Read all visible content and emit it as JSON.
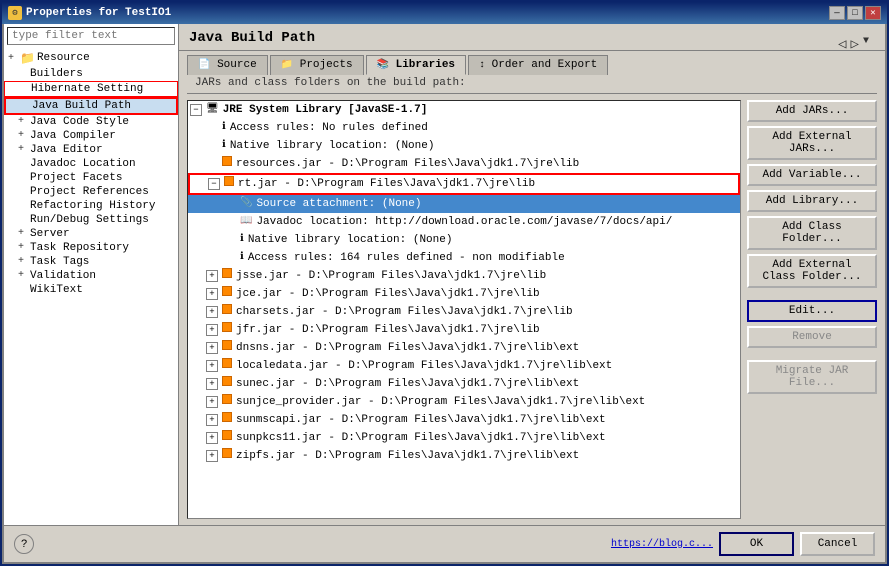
{
  "window": {
    "title": "Properties for TestIO1",
    "title_icon": "⚙"
  },
  "title_buttons": [
    "—",
    "□",
    "✕"
  ],
  "sidebar": {
    "filter_placeholder": "type filter text",
    "items": [
      {
        "label": "Resource",
        "level": 0,
        "expand": "+",
        "icon": "folder"
      },
      {
        "label": "Builders",
        "level": 1,
        "expand": "",
        "icon": ""
      },
      {
        "label": "Hibernate Setting",
        "level": 1,
        "expand": "",
        "icon": ""
      },
      {
        "label": "Java Build Path",
        "level": 1,
        "expand": "",
        "icon": "",
        "highlighted": true
      },
      {
        "label": "Java Code Style",
        "level": 1,
        "expand": "+",
        "icon": ""
      },
      {
        "label": "Java Compiler",
        "level": 1,
        "expand": "+",
        "icon": ""
      },
      {
        "label": "Java Editor",
        "level": 1,
        "expand": "+",
        "icon": ""
      },
      {
        "label": "Javadoc Location",
        "level": 1,
        "expand": "",
        "icon": ""
      },
      {
        "label": "Project Facets",
        "level": 1,
        "expand": "",
        "icon": ""
      },
      {
        "label": "Project References",
        "level": 1,
        "expand": "",
        "icon": ""
      },
      {
        "label": "Refactoring History",
        "level": 1,
        "expand": "",
        "icon": ""
      },
      {
        "label": "Run/Debug Settings",
        "level": 1,
        "expand": "",
        "icon": ""
      },
      {
        "label": "Server",
        "level": 1,
        "expand": "+",
        "icon": ""
      },
      {
        "label": "Task Repository",
        "level": 1,
        "expand": "+",
        "icon": ""
      },
      {
        "label": "Task Tags",
        "level": 1,
        "expand": "+",
        "icon": ""
      },
      {
        "label": "Validation",
        "level": 1,
        "expand": "+",
        "icon": ""
      },
      {
        "label": "WikiText",
        "level": 1,
        "expand": "",
        "icon": ""
      }
    ]
  },
  "main": {
    "title": "Java Build Path",
    "tabs": [
      {
        "label": "Source",
        "icon": "📄",
        "active": false
      },
      {
        "label": "Projects",
        "icon": "📁",
        "active": false
      },
      {
        "label": "Libraries",
        "icon": "📚",
        "active": true
      },
      {
        "label": "Order and Export",
        "icon": "📋",
        "active": false
      }
    ],
    "desc": "JARs and class folders on the build path:",
    "tree_items": [
      {
        "indent": 0,
        "expand": "−",
        "icon": "jre",
        "text": "JRE System Library [JavaSE-1.7]",
        "bold": true
      },
      {
        "indent": 1,
        "expand": "",
        "icon": "info",
        "text": "Access rules: No rules defined"
      },
      {
        "indent": 1,
        "expand": "",
        "icon": "info",
        "text": "Native library location: (None)"
      },
      {
        "indent": 1,
        "expand": "",
        "icon": "jar",
        "text": "resources.jar - D:\\Program Files\\Java\\jdk1.7\\jre\\lib"
      },
      {
        "indent": 1,
        "expand": "−",
        "icon": "jar",
        "text": "rt.jar - D:\\Program Files\\Java\\jdk1.7\\jre\\lib",
        "highlighted": true
      },
      {
        "indent": 2,
        "expand": "",
        "icon": "src",
        "text": "Source attachment: (None)",
        "selected": true
      },
      {
        "indent": 2,
        "expand": "",
        "icon": "info",
        "text": "Javadoc location: http://download.oracle.com/javase/7/docs/api/"
      },
      {
        "indent": 2,
        "expand": "",
        "icon": "info",
        "text": "Native library location: (None)"
      },
      {
        "indent": 2,
        "expand": "",
        "icon": "info",
        "text": "Access rules: 164 rules defined - non modifiable"
      },
      {
        "indent": 1,
        "expand": "+",
        "icon": "jar",
        "text": "jsse.jar - D:\\Program Files\\Java\\jdk1.7\\jre\\lib"
      },
      {
        "indent": 1,
        "expand": "+",
        "icon": "jar",
        "text": "jce.jar - D:\\Program Files\\Java\\jdk1.7\\jre\\lib"
      },
      {
        "indent": 1,
        "expand": "+",
        "icon": "jar",
        "text": "charsets.jar - D:\\Program Files\\Java\\jdk1.7\\jre\\lib"
      },
      {
        "indent": 1,
        "expand": "+",
        "icon": "jar",
        "text": "jfr.jar - D:\\Program Files\\Java\\jdk1.7\\jre\\lib"
      },
      {
        "indent": 1,
        "expand": "+",
        "icon": "jar",
        "text": "dnsns.jar - D:\\Program Files\\Java\\jdk1.7\\jre\\lib\\ext"
      },
      {
        "indent": 1,
        "expand": "+",
        "icon": "jar",
        "text": "localedata.jar - D:\\Program Files\\Java\\jdk1.7\\jre\\lib\\ext"
      },
      {
        "indent": 1,
        "expand": "+",
        "icon": "jar",
        "text": "sunec.jar - D:\\Program Files\\Java\\jdk1.7\\jre\\lib\\ext"
      },
      {
        "indent": 1,
        "expand": "+",
        "icon": "jar",
        "text": "sunjce_provider.jar - D:\\Program Files\\Java\\jdk1.7\\jre\\lib\\ext"
      },
      {
        "indent": 1,
        "expand": "+",
        "icon": "jar",
        "text": "sunmscapi.jar - D:\\Program Files\\Java\\jdk1.7\\jre\\lib\\ext"
      },
      {
        "indent": 1,
        "expand": "+",
        "icon": "jar",
        "text": "sunpkcs11.jar - D:\\Program Files\\Java\\jdk1.7\\jre\\lib\\ext"
      },
      {
        "indent": 1,
        "expand": "+",
        "icon": "jar",
        "text": "zipfs.jar - D:\\Program Files\\Java\\jdk1.7\\jre\\lib\\ext"
      }
    ],
    "buttons": [
      {
        "label": "Add JARs...",
        "enabled": true,
        "primary": false
      },
      {
        "label": "Add External JARs...",
        "enabled": true,
        "primary": false
      },
      {
        "label": "Add Variable...",
        "enabled": true,
        "primary": false
      },
      {
        "label": "Add Library...",
        "enabled": true,
        "primary": false
      },
      {
        "label": "Add Class Folder...",
        "enabled": true,
        "primary": false
      },
      {
        "label": "Add External Class Folder...",
        "enabled": true,
        "primary": false
      },
      {
        "label": "Edit...",
        "enabled": true,
        "primary": true
      },
      {
        "label": "Remove",
        "enabled": false,
        "primary": false
      },
      {
        "label": "Migrate JAR File...",
        "enabled": false,
        "primary": false
      }
    ]
  },
  "bottom": {
    "help_label": "?",
    "link_text": "https://blog.c...",
    "ok_label": "OK",
    "cancel_label": "Cancel"
  }
}
